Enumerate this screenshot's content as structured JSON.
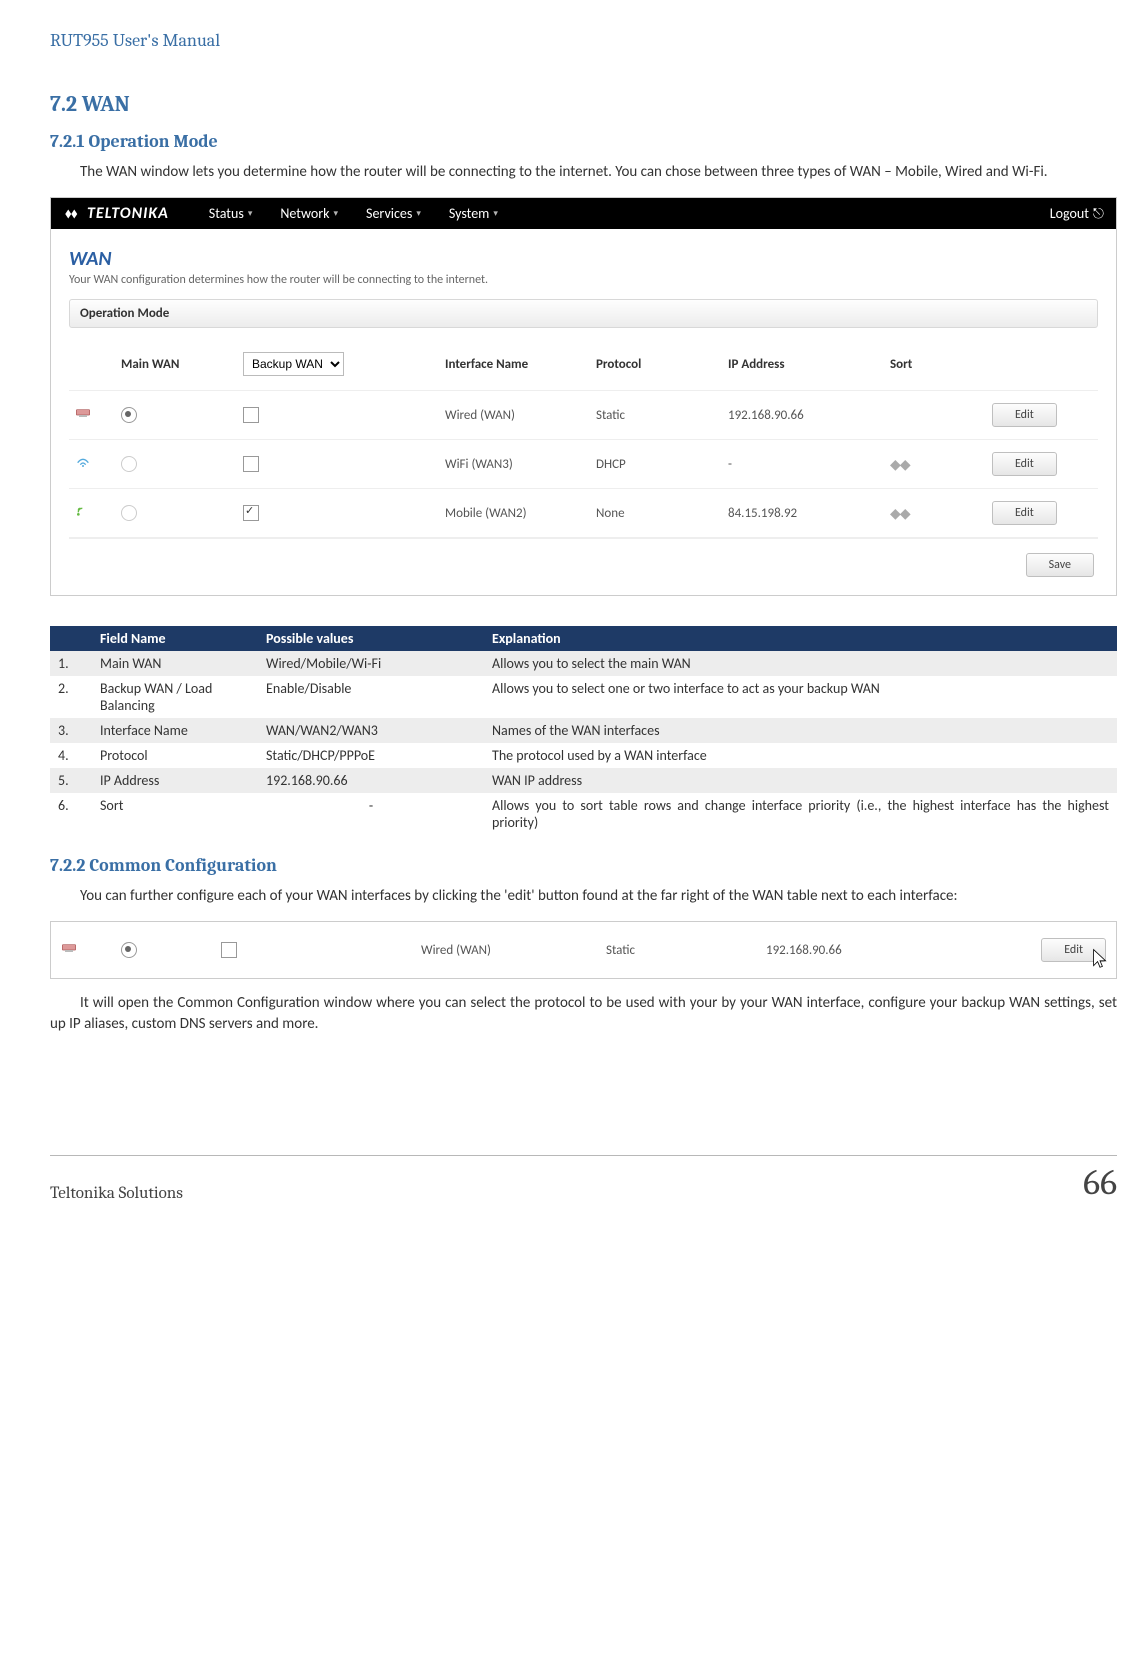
{
  "doc": {
    "header": "RUT955 User's Manual",
    "section": "7.2    WAN",
    "sub1": "7.2.1 Operation Mode",
    "p1": "The WAN window lets you determine how the router will be connecting to the internet. You can chose between three types of WAN – Mobile, Wired and Wi-Fi.",
    "sub2": "7.2.2 Common Configuration",
    "p2": "You can further configure each of your WAN interfaces by clicking the 'edit' button found at the far right of the WAN table next to each interface:",
    "p3": "It will open the Common Configuration window where you can select the protocol to be used with your by your WAN interface, configure your backup WAN settings, set up IP aliases, custom DNS servers and more."
  },
  "ui": {
    "brand": "TELTONIKA",
    "nav": [
      "Status",
      "Network",
      "Services",
      "System"
    ],
    "logout": "Logout",
    "page_title": "WAN",
    "desc": "Your WAN configuration determines how the router will be connecting to the internet.",
    "panel_title": "Operation Mode",
    "cols": {
      "main": "Main WAN",
      "backup_sel": "Backup WAN",
      "iface": "Interface Name",
      "proto": "Protocol",
      "ip": "IP Address",
      "sort": "Sort"
    },
    "rows": [
      {
        "icon": "wired",
        "main_checked": true,
        "backup_checked": false,
        "iface": "Wired (WAN)",
        "proto": "Static",
        "ip": "192.168.90.66",
        "sort": false
      },
      {
        "icon": "wifi",
        "main_checked": false,
        "backup_checked": false,
        "iface": "WiFi (WAN3)",
        "proto": "DHCP",
        "ip": "-",
        "sort": true
      },
      {
        "icon": "mobile",
        "main_checked": false,
        "backup_checked": true,
        "iface": "Mobile (WAN2)",
        "proto": "None",
        "ip": "84.15.198.92",
        "sort": true
      }
    ],
    "edit": "Edit",
    "save": "Save"
  },
  "fields": {
    "headers": {
      "name": "Field Name",
      "vals": "Possible values",
      "expl": "Explanation"
    },
    "rows": [
      {
        "n": "1.",
        "name": "Main WAN",
        "vals": "Wired/Mobile/Wi-Fi",
        "expl": "Allows you to select the main WAN"
      },
      {
        "n": "2.",
        "name": "Backup WAN / Load Balancing",
        "vals": "Enable/Disable",
        "expl": "Allows you to select one or two interface to act as your backup WAN"
      },
      {
        "n": "3.",
        "name": "Interface Name",
        "vals": "WAN/WAN2/WAN3",
        "expl": "Names of the WAN interfaces"
      },
      {
        "n": "4.",
        "name": "Protocol",
        "vals": "Static/DHCP/PPPoE",
        "expl": "The protocol used by a WAN interface"
      },
      {
        "n": "5.",
        "name": "IP Address",
        "vals": "192.168.90.66",
        "expl": "WAN IP address"
      },
      {
        "n": "6.",
        "name": "Sort",
        "vals": "-",
        "expl": "Allows you to sort table rows and change interface priority (i.e., the highest interface has the highest priority)"
      }
    ]
  },
  "shot2": {
    "iface": "Wired (WAN)",
    "proto": "Static",
    "ip": "192.168.90.66",
    "edit": "Edit"
  },
  "footer": {
    "left": "Teltonika Solutions",
    "page": "66"
  }
}
